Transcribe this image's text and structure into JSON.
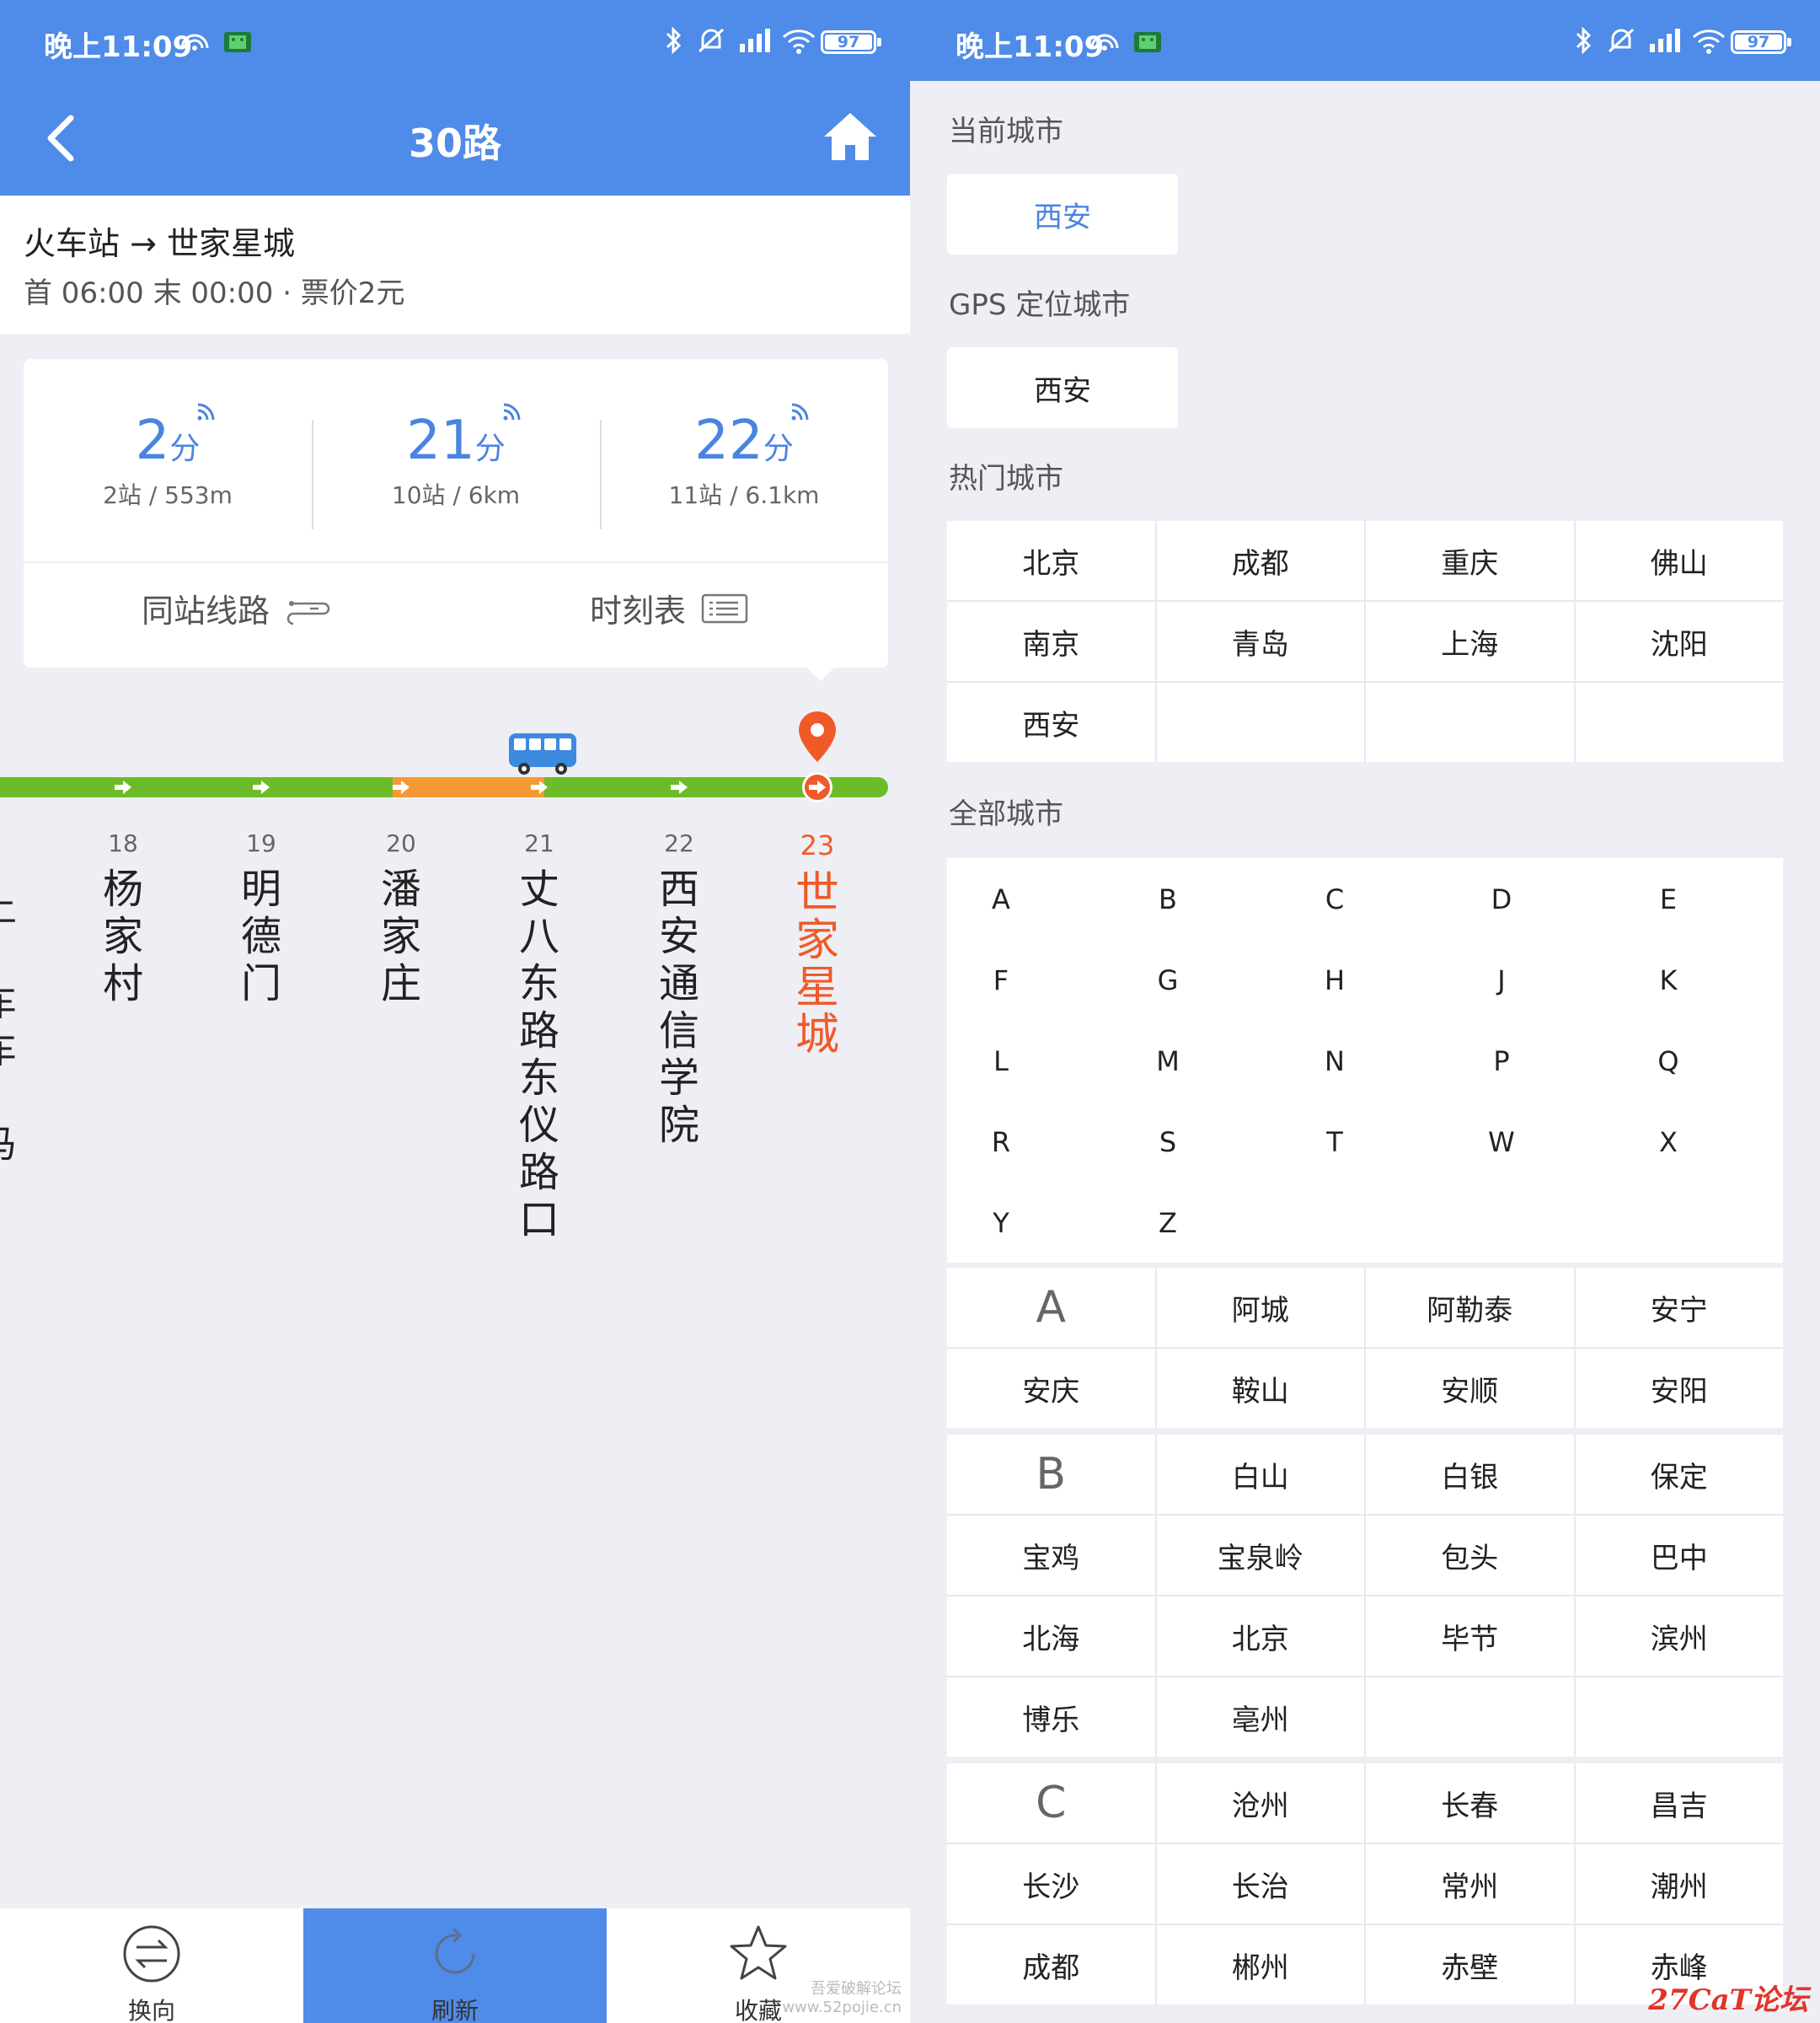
{
  "status": {
    "time": "晚上11:09",
    "battery": "97",
    "battery_pct": 97
  },
  "left": {
    "nav": {
      "title": "30路"
    },
    "route": {
      "title": "火车站 → 世家星城",
      "sub": "首 06:00 末 00:00 · 票价2元"
    },
    "eta": [
      {
        "value": "2",
        "unit": "分",
        "detail": "2站 / 553m"
      },
      {
        "value": "21",
        "unit": "分",
        "detail": "10站 / 6km"
      },
      {
        "value": "22",
        "unit": "分",
        "detail": "11站 / 6.1km"
      }
    ],
    "actions": {
      "same_station": "同站线路",
      "timetable": "时刻表"
    },
    "partial_station": "上·车车·马",
    "stations": [
      {
        "num": "18",
        "name": "杨家村"
      },
      {
        "num": "19",
        "name": "明德门"
      },
      {
        "num": "20",
        "name": "潘家庄"
      },
      {
        "num": "21",
        "name": "丈八东路东仪路口"
      },
      {
        "num": "22",
        "name": "西安通信学院"
      },
      {
        "num": "23",
        "name": "世家星城"
      }
    ],
    "bottom": {
      "reverse": "换向",
      "refresh": "刷新",
      "favorite": "收藏"
    },
    "watermark": "吾爱破解论坛\nwww.52pojie.cn"
  },
  "right": {
    "current_label": "当前城市",
    "current_city": "西安",
    "gps_label": "GPS 定位城市",
    "gps_city": "西安",
    "hot_label": "热门城市",
    "hot_cities": [
      "北京",
      "成都",
      "重庆",
      "佛山",
      "南京",
      "青岛",
      "上海",
      "沈阳",
      "西安",
      "",
      "",
      ""
    ],
    "all_label": "全部城市",
    "alphabet": [
      [
        "A",
        "B",
        "C",
        "D",
        "E"
      ],
      [
        "F",
        "G",
        "H",
        "J",
        "K"
      ],
      [
        "L",
        "M",
        "N",
        "P",
        "Q"
      ],
      [
        "R",
        "S",
        "T",
        "W",
        "X"
      ],
      [
        "Y",
        "Z"
      ]
    ],
    "groups": [
      {
        "letter": "A",
        "cities": [
          "阿城",
          "阿勒泰",
          "安宁",
          "安庆",
          "鞍山",
          "安顺",
          "安阳"
        ]
      },
      {
        "letter": "B",
        "cities": [
          "白山",
          "白银",
          "保定",
          "宝鸡",
          "宝泉岭",
          "包头",
          "巴中",
          "北海",
          "北京",
          "毕节",
          "滨州",
          "博乐",
          "亳州"
        ]
      },
      {
        "letter": "C",
        "cities": [
          "沧州",
          "长春",
          "昌吉",
          "长沙",
          "长治",
          "常州",
          "潮州",
          "成都",
          "郴州",
          "赤壁",
          "赤峰"
        ]
      }
    ],
    "watermark": "27CaT论坛"
  },
  "colors": {
    "primary": "#4f8be8",
    "green": "#6cbb29",
    "orange": "#f39a35",
    "accent": "#f05a28"
  },
  "icons": [
    "back-arrow-icon",
    "home-icon",
    "signal-icon",
    "route-switch-icon",
    "timetable-icon",
    "bus-icon",
    "location-pin-icon",
    "swap-icon",
    "refresh-icon",
    "star-icon"
  ]
}
